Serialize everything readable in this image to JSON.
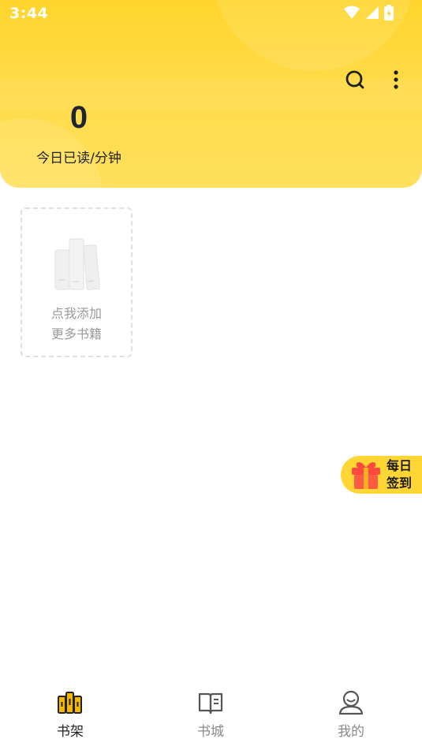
{
  "status_bar": {
    "time": "3:44"
  },
  "header": {
    "read_minutes": "0",
    "read_label": "今日已读/分钟"
  },
  "shelf": {
    "add_line1": "点我添加",
    "add_line2": "更多书籍"
  },
  "checkin": {
    "line1": "每日",
    "line2": "签到"
  },
  "bottom_nav": {
    "items": [
      {
        "label": "书架",
        "icon": "bookshelf-icon",
        "active": true
      },
      {
        "label": "书城",
        "icon": "book-open-icon",
        "active": false
      },
      {
        "label": "我的",
        "icon": "user-icon",
        "active": false
      }
    ]
  },
  "colors": {
    "accent": "#FFD52C",
    "active_icon": "#F5B800",
    "gift": "#FF4A3D"
  }
}
